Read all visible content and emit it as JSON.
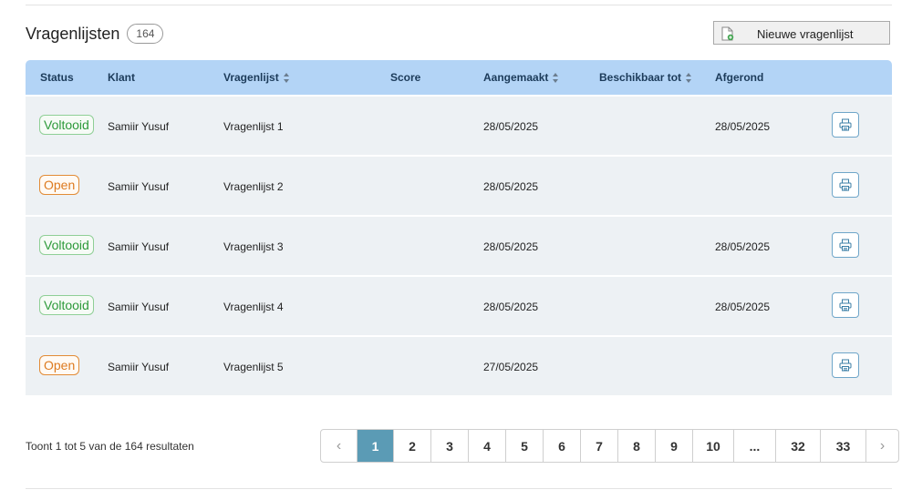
{
  "header": {
    "title": "Vragenlijsten",
    "count": "164"
  },
  "toolbar": {
    "new_label": "Nieuwe vragenlijst",
    "new_icon": "new-document-icon"
  },
  "table": {
    "columns": {
      "status": "Status",
      "klant": "Klant",
      "vragenlijst": "Vragenlijst",
      "score": "Score",
      "aangemaakt": "Aangemaakt",
      "beschikbaar": "Beschikbaar tot",
      "afgerond": "Afgerond"
    },
    "rows": [
      {
        "status": "Voltooid",
        "status_type": "done",
        "klant": "Samiir Yusuf",
        "vragenlijst": "Vragenlijst 1",
        "score": "",
        "aangemaakt": "28/05/2025",
        "beschikbaar": "",
        "afgerond": "28/05/2025"
      },
      {
        "status": "Open",
        "status_type": "open",
        "klant": "Samiir Yusuf",
        "vragenlijst": "Vragenlijst 2",
        "score": "",
        "aangemaakt": "28/05/2025",
        "beschikbaar": "",
        "afgerond": ""
      },
      {
        "status": "Voltooid",
        "status_type": "done",
        "klant": "Samiir Yusuf",
        "vragenlijst": "Vragenlijst 3",
        "score": "",
        "aangemaakt": "28/05/2025",
        "beschikbaar": "",
        "afgerond": "28/05/2025"
      },
      {
        "status": "Voltooid",
        "status_type": "done",
        "klant": "Samiir Yusuf",
        "vragenlijst": "Vragenlijst 4",
        "score": "",
        "aangemaakt": "28/05/2025",
        "beschikbaar": "",
        "afgerond": "28/05/2025"
      },
      {
        "status": "Open",
        "status_type": "open",
        "klant": "Samiir Yusuf",
        "vragenlijst": "Vragenlijst 5",
        "score": "",
        "aangemaakt": "27/05/2025",
        "beschikbaar": "",
        "afgerond": ""
      }
    ]
  },
  "footer": {
    "result_text": "Toont 1 tot 5 van de 164 resultaten"
  },
  "pagination": {
    "prev": "‹",
    "next": "›",
    "pages": [
      "1",
      "2",
      "3",
      "4",
      "5",
      "6",
      "7",
      "8",
      "9",
      "10",
      "...",
      "32",
      "33"
    ],
    "active": "1"
  },
  "colors": {
    "header_bg": "#b3d4f6",
    "row_bg": "#edf1f4",
    "active_page": "#5b9bb5",
    "done": "#2e9a3b",
    "open": "#dd7a1f"
  }
}
